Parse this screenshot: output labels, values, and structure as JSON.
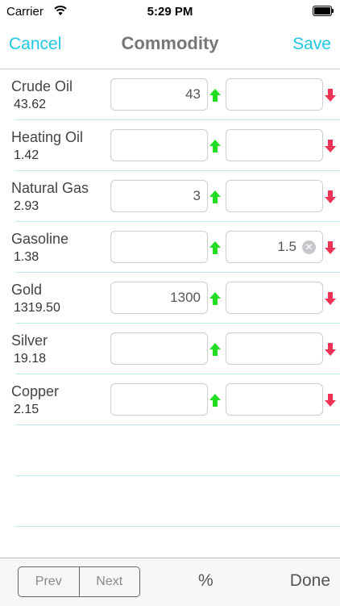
{
  "status_bar": {
    "carrier": "Carrier",
    "time": "5:29 PM"
  },
  "nav": {
    "cancel_label": "Cancel",
    "title": "Commodity",
    "save_label": "Save"
  },
  "colors": {
    "accent": "#1fc7e4",
    "up_arrow": "#22dd22",
    "down_arrow": "#ee3355",
    "separator": "#bdebf4"
  },
  "commodities": [
    {
      "name": "Crude Oil",
      "price": "43.62",
      "up_value": "43",
      "down_value": ""
    },
    {
      "name": "Heating Oil",
      "price": "1.42",
      "up_value": "",
      "down_value": ""
    },
    {
      "name": "Natural Gas",
      "price": "2.93",
      "up_value": "3",
      "down_value": ""
    },
    {
      "name": "Gasoline",
      "price": "1.38",
      "up_value": "",
      "down_value": "1.5"
    },
    {
      "name": "Gold",
      "price": "1319.50",
      "up_value": "1300",
      "down_value": ""
    },
    {
      "name": "Silver",
      "price": "19.18",
      "up_value": "",
      "down_value": ""
    },
    {
      "name": "Copper",
      "price": "2.15",
      "up_value": "",
      "down_value": ""
    }
  ],
  "icons": {
    "up": "up-arrow-icon",
    "down": "down-arrow-icon",
    "clear": "clear-x-icon"
  },
  "toolbar": {
    "prev_label": "Prev",
    "next_label": "Next",
    "percent_label": "%",
    "done_label": "Done"
  }
}
